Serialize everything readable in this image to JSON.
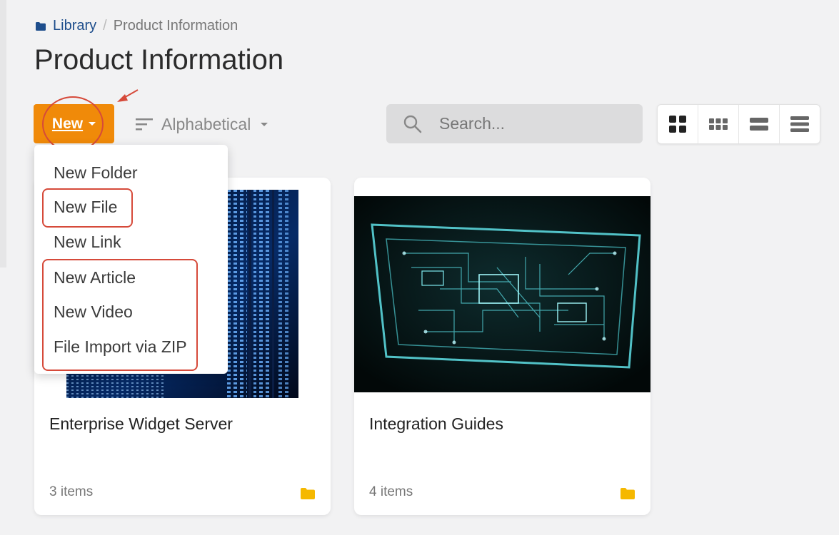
{
  "breadcrumb": {
    "root": "Library",
    "separator": "/",
    "current": "Product Information"
  },
  "page_title": "Product Information",
  "toolbar": {
    "new_label": "New",
    "sort_label": "Alphabetical",
    "search_placeholder": "Search...",
    "view_modes": [
      "large-grid",
      "small-grid",
      "list",
      "compact-list"
    ],
    "selected_view": "large-grid"
  },
  "new_menu": {
    "items": [
      {
        "label": "New Folder"
      },
      {
        "label": "New File"
      },
      {
        "label": "New Link"
      },
      {
        "label": "New Article"
      },
      {
        "label": "New Video"
      },
      {
        "label": "File Import via ZIP"
      }
    ]
  },
  "cards": [
    {
      "title": "Enterprise Widget Server",
      "count": "3 items"
    },
    {
      "title": "Integration Guides",
      "count": "4 items"
    }
  ],
  "colors": {
    "accent": "#f08a09",
    "annotation": "#d64a3a",
    "link": "#1e4e8c",
    "folder": "#f5b800"
  },
  "icons": [
    "folder-icon",
    "caret-down-icon",
    "sort-icon",
    "search-icon",
    "grid-large-icon",
    "grid-small-icon",
    "list-icon",
    "compact-list-icon"
  ]
}
